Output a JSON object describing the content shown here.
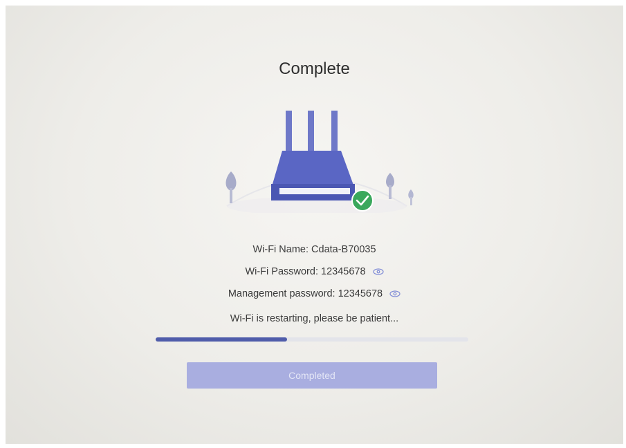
{
  "page": {
    "title": "Complete"
  },
  "info": {
    "wifi_name": "Wi-Fi Name: Cdata-B70035",
    "wifi_password": "Wi-Fi Password: 12345678",
    "management_password": "Management password: 12345678",
    "status": "Wi-Fi is restarting, please be patient..."
  },
  "progress": {
    "value": 0.42
  },
  "button": {
    "label": "Completed"
  },
  "icons": {
    "router": "router-icon",
    "success": "check-circle-icon",
    "show_password": "eye-icon",
    "tree": "tree-icon"
  },
  "colors": {
    "accent": "#4f5caa",
    "router_body": "#5a66c4",
    "success": "#3aa85c",
    "button_disabled": "#a9aee0"
  }
}
